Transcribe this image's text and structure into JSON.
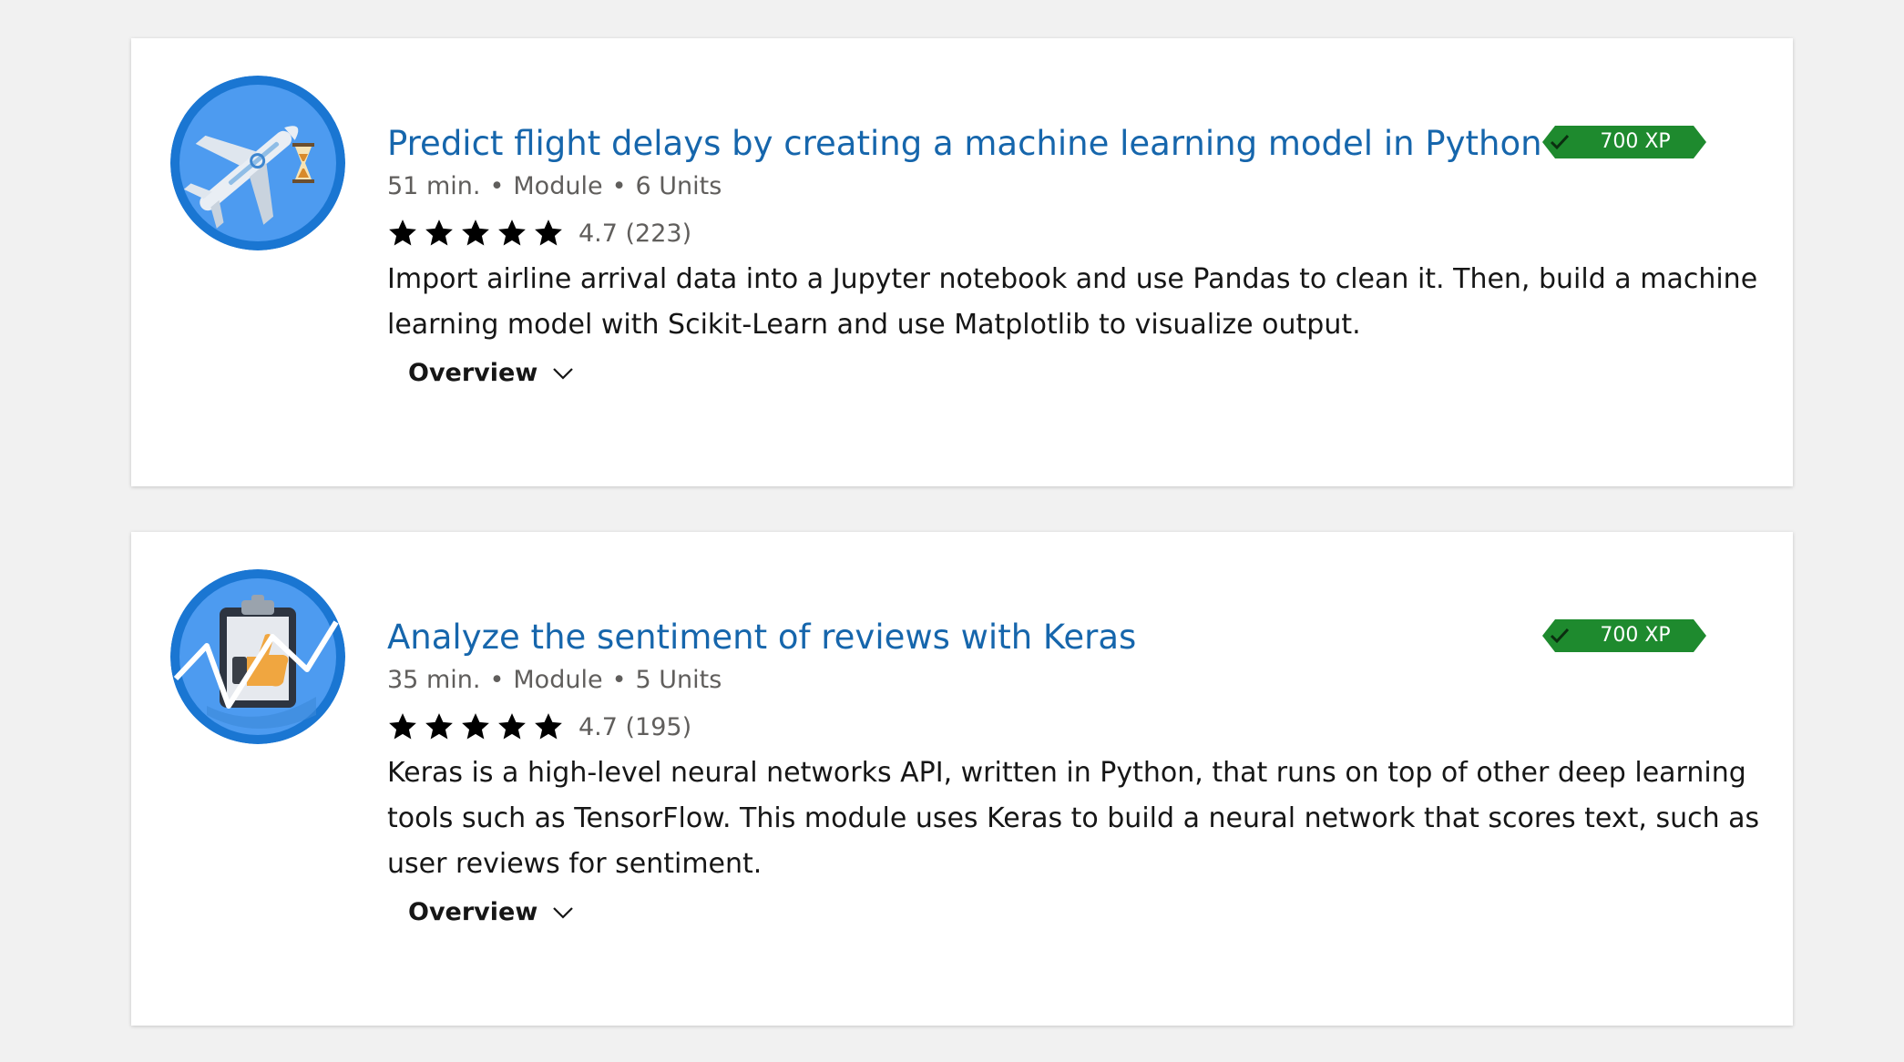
{
  "modules": [
    {
      "title": "Predict flight delays by creating a machine learning model in Python",
      "duration": "51 min.",
      "type": "Module",
      "units": "6 Units",
      "rating": "4.7 (223)",
      "stars": 5,
      "description": "Import airline arrival data into a Jupyter notebook and use Pandas to clean it. Then, build a machine learning model with Scikit-Learn and use Matplotlib to visualize output.",
      "overview_label": "Overview",
      "xp": "700 XP",
      "icon": "airplane-hourglass-icon"
    },
    {
      "title": "Analyze the sentiment of reviews with Keras",
      "duration": "35 min.",
      "type": "Module",
      "units": "5 Units",
      "rating": "4.7 (195)",
      "stars": 5,
      "description": "Keras is a high-level neural networks API, written in Python, that runs on top of other deep learning tools such as TensorFlow. This module uses Keras to build a neural network that scores text, such as user reviews for sentiment.",
      "overview_label": "Overview",
      "xp": "700 XP",
      "icon": "clipboard-thumbs-up-icon"
    }
  ],
  "colors": {
    "title": "#1666ac",
    "xp_badge": "#1e8a2e",
    "icon_ring": "#1a76d2",
    "icon_fill": "#4d9bf0",
    "background": "#f1f1f1"
  },
  "separator": "•"
}
